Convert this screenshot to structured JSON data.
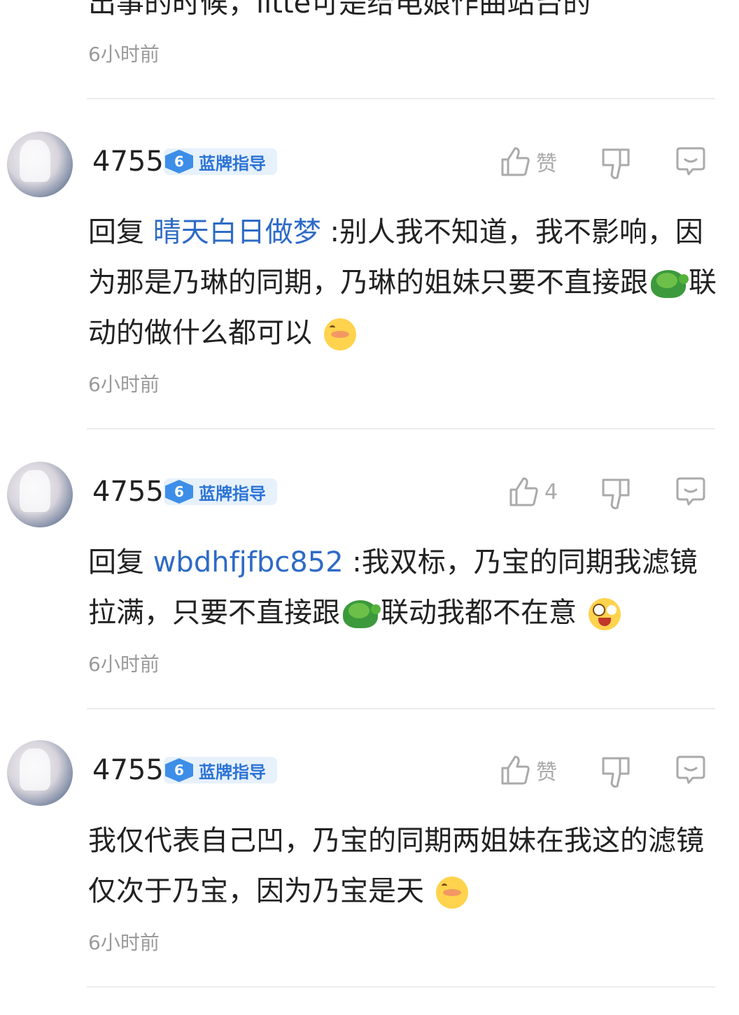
{
  "top_partial": {
    "text": "出事的时候，litte可是给电娘作曲站台的",
    "time": "6小时前"
  },
  "comments": [
    {
      "username": "4755",
      "badge_level": "6",
      "badge_text": "蓝牌指导",
      "like_label": "赞",
      "reply_prefix": "回复",
      "mention": "晴天白日做梦",
      "text_a": " :别人我不知道，我不影响，因为那是乃琳的同期，乃琳的姐妹只要不直接跟",
      "text_b": "联动的做什么都可以",
      "emoji_mid": "turtle-emoji",
      "emoji_end": "shy-face-emoji",
      "time": "6小时前"
    },
    {
      "username": "4755",
      "badge_level": "6",
      "badge_text": "蓝牌指导",
      "like_label": "4",
      "reply_prefix": "回复",
      "mention": "wbdhfjfbc852",
      "text_a": " :我双标，乃宝的同期我滤镜拉满，只要不直接跟",
      "text_b": "联动我都不在意",
      "emoji_mid": "turtle-emoji",
      "emoji_end": "crazy-face-emoji",
      "time": "6小时前"
    },
    {
      "username": "4755",
      "badge_level": "6",
      "badge_text": "蓝牌指导",
      "like_label": "赞",
      "text_a": "我仅代表自己凹，乃宝的同期两姐妹在我这的滤镜仅次于乃宝，因为乃宝是天",
      "emoji_end": "shy-face-emoji",
      "time": "6小时前"
    }
  ],
  "colors": {
    "mention": "#2e6bc6",
    "badge_bg": "#e7f1fc",
    "badge_text": "#2c74d6",
    "muted": "#9a9a9a",
    "icon": "#aaaaaa"
  }
}
